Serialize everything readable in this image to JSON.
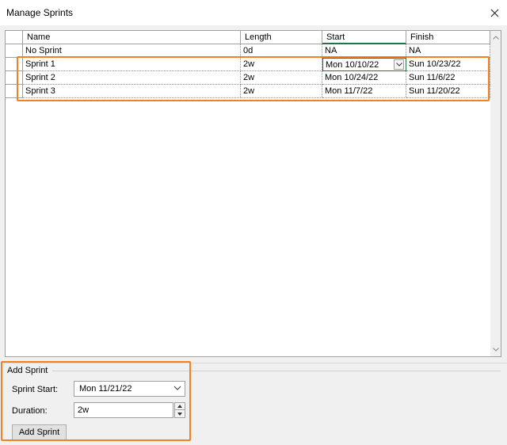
{
  "window": {
    "title": "Manage Sprints"
  },
  "grid": {
    "columns": [
      "Name",
      "Length",
      "Start",
      "Finish"
    ],
    "rows": [
      {
        "name": "No Sprint",
        "length": "0d",
        "start": "NA",
        "finish": "NA"
      },
      {
        "name": "Sprint 1",
        "length": "2w",
        "start": "Mon 10/10/22",
        "finish": "Sun 10/23/22"
      },
      {
        "name": "Sprint 2",
        "length": "2w",
        "start": "Mon 10/24/22",
        "finish": "Sun 11/6/22"
      },
      {
        "name": "Sprint 3",
        "length": "2w",
        "start": "Mon 11/7/22",
        "finish": "Sun 11/20/22"
      }
    ]
  },
  "add_sprint": {
    "group_label": "Add Sprint",
    "start_label": "Sprint Start:",
    "start_value": "Mon 11/21/22",
    "duration_label": "Duration:",
    "duration_value": "2w",
    "button_label": "Add Sprint"
  },
  "colors": {
    "highlight": "#f4801f",
    "active_cell": "#217346"
  },
  "icons": {
    "close": "close-icon",
    "dropdown": "chevron-down-icon",
    "spin_up": "chevron-up-icon",
    "spin_down": "chevron-down-icon"
  }
}
